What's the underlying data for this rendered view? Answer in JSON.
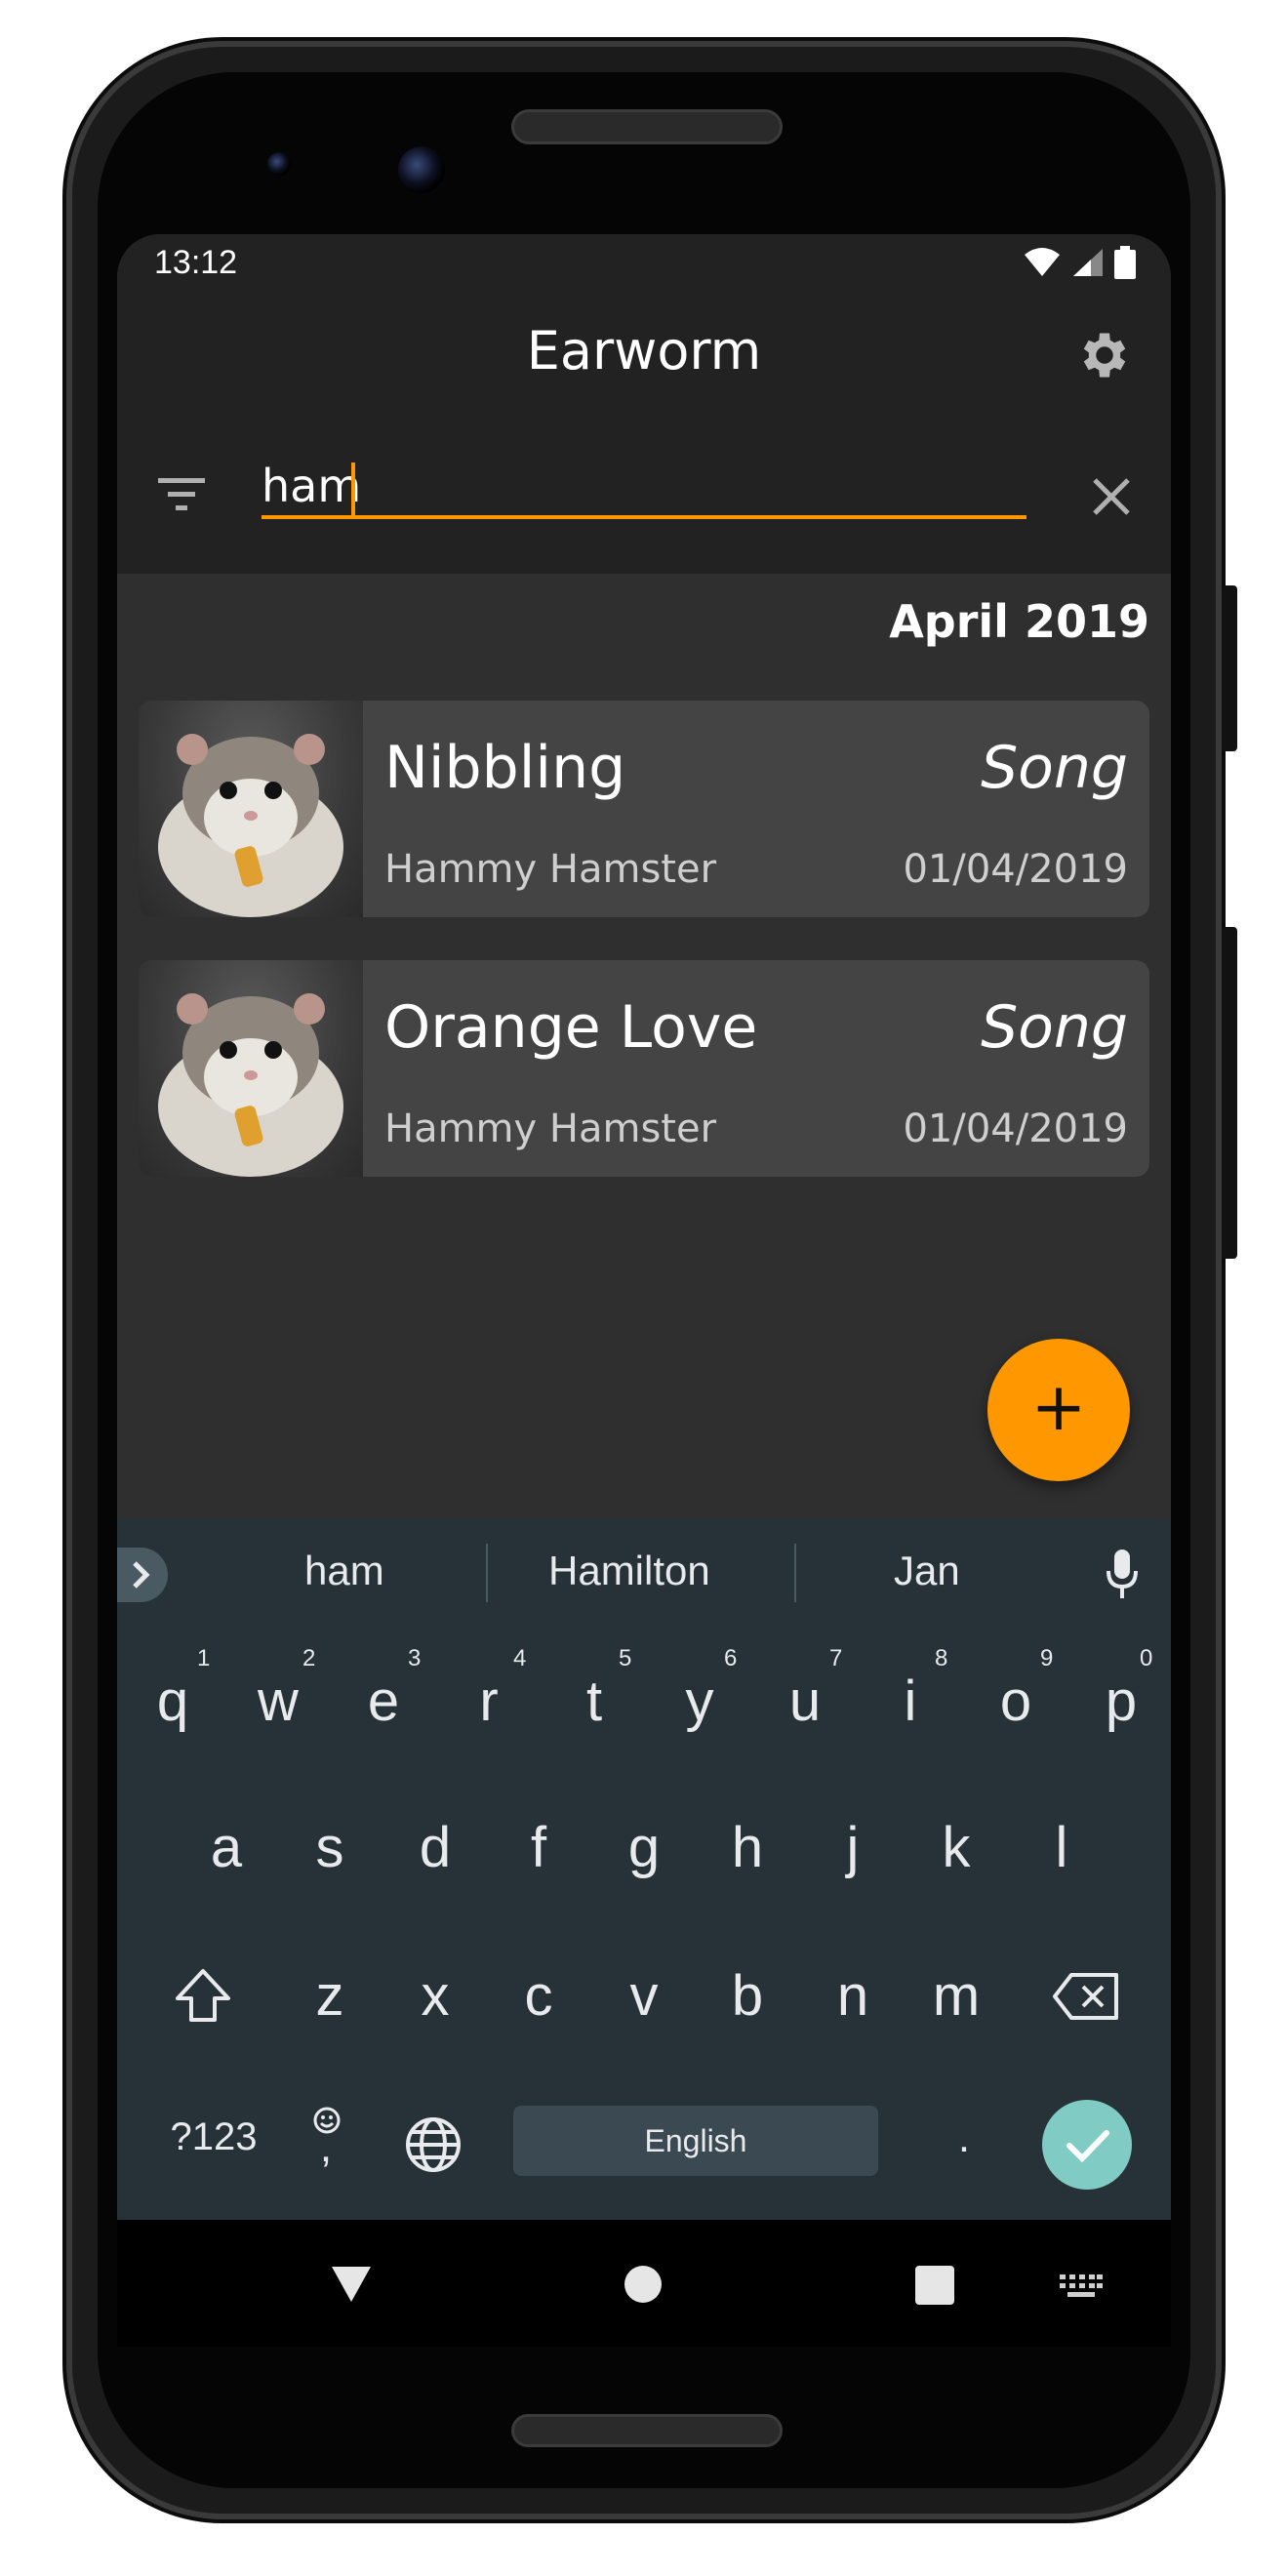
{
  "status_bar": {
    "time": "13:12"
  },
  "app_bar": {
    "title": "Earworm",
    "settings_icon": "gear-icon"
  },
  "search": {
    "value": "ham",
    "filter_icon": "filter-icon",
    "clear_icon": "close-icon"
  },
  "section": {
    "header": "April 2019"
  },
  "results": [
    {
      "title": "Nibbling",
      "type": "Song",
      "artist": "Hammy Hamster",
      "date": "01/04/2019"
    },
    {
      "title": "Orange Love",
      "type": "Song",
      "artist": "Hammy Hamster",
      "date": "01/04/2019"
    }
  ],
  "fab": {
    "label": "+"
  },
  "keyboard": {
    "suggestions": [
      "ham",
      "Hamilton",
      "Jan"
    ],
    "row1": [
      "q",
      "w",
      "e",
      "r",
      "t",
      "y",
      "u",
      "i",
      "o",
      "p"
    ],
    "row1_hints": [
      "1",
      "2",
      "3",
      "4",
      "5",
      "6",
      "7",
      "8",
      "9",
      "0"
    ],
    "row2": [
      "a",
      "s",
      "d",
      "f",
      "g",
      "h",
      "j",
      "k",
      "l"
    ],
    "row3": [
      "z",
      "x",
      "c",
      "v",
      "b",
      "n",
      "m"
    ],
    "symbols_key": "?123",
    "emoji_comma_key": ",",
    "space_label": "English",
    "period_key": "."
  },
  "colors": {
    "accent": "#ff9800",
    "enter": "#80cbc4",
    "keyboard_bg": "#263238",
    "app_bg": "#2f2f2f",
    "toolbar_bg": "#222222"
  }
}
